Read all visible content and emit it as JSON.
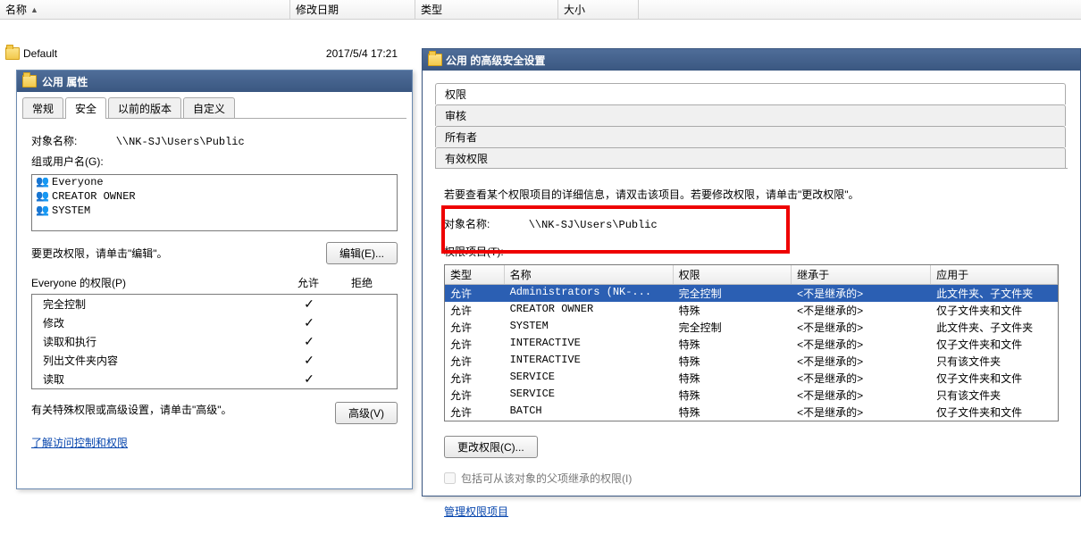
{
  "explorer": {
    "columns": {
      "name": "名称",
      "date": "修改日期",
      "type": "类型",
      "size": "大小"
    },
    "rows": [
      {
        "name": "Default",
        "date": "2017/5/4 17:21"
      }
    ]
  },
  "dialog1": {
    "title": "公用 属性",
    "tabs": [
      "常规",
      "安全",
      "以前的版本",
      "自定义"
    ],
    "active_tab": 1,
    "object_label": "对象名称:",
    "object_path": "\\\\NK-SJ\\Users\\Public",
    "group_label": "组或用户名(G):",
    "groups": [
      "Everyone",
      "CREATOR OWNER",
      "SYSTEM"
    ],
    "edit_hint": "要更改权限，请单击\"编辑\"。",
    "edit_btn": "编辑(E)...",
    "perm_header": "Everyone 的权限(P)",
    "allow_label": "允许",
    "deny_label": "拒绝",
    "perms": [
      {
        "name": "完全控制",
        "allow": true
      },
      {
        "name": "修改",
        "allow": true
      },
      {
        "name": "读取和执行",
        "allow": true
      },
      {
        "name": "列出文件夹内容",
        "allow": true
      },
      {
        "name": "读取",
        "allow": true
      }
    ],
    "adv_hint": "有关特殊权限或高级设置，请单击\"高级\"。",
    "adv_btn": "高级(V)",
    "learn_link": "了解访问控制和权限"
  },
  "dialog2": {
    "title": "公用 的高级安全设置",
    "tabs": [
      "权限",
      "审核",
      "所有者",
      "有效权限"
    ],
    "active_tab": 0,
    "hint": "若要查看某个权限项目的详细信息，请双击该项目。若要修改权限，请单击\"更改权限\"。",
    "object_label": "对象名称:",
    "object_path": "\\\\NK-SJ\\Users\\Public",
    "entries_label": "权限项目(T):",
    "columns": {
      "type": "类型",
      "name": "名称",
      "perm": "权限",
      "inherit": "继承于",
      "apply": "应用于"
    },
    "rows": [
      {
        "type": "允许",
        "name": "Administrators (NK-...",
        "perm": "完全控制",
        "inherit": "<不是继承的>",
        "apply": "此文件夹、子文件夹",
        "selected": true
      },
      {
        "type": "允许",
        "name": "CREATOR OWNER",
        "perm": "特殊",
        "inherit": "<不是继承的>",
        "apply": "仅子文件夹和文件"
      },
      {
        "type": "允许",
        "name": "SYSTEM",
        "perm": "完全控制",
        "inherit": "<不是继承的>",
        "apply": "此文件夹、子文件夹"
      },
      {
        "type": "允许",
        "name": "INTERACTIVE",
        "perm": "特殊",
        "inherit": "<不是继承的>",
        "apply": "仅子文件夹和文件"
      },
      {
        "type": "允许",
        "name": "INTERACTIVE",
        "perm": "特殊",
        "inherit": "<不是继承的>",
        "apply": "只有该文件夹"
      },
      {
        "type": "允许",
        "name": "SERVICE",
        "perm": "特殊",
        "inherit": "<不是继承的>",
        "apply": "仅子文件夹和文件"
      },
      {
        "type": "允许",
        "name": "SERVICE",
        "perm": "特殊",
        "inherit": "<不是继承的>",
        "apply": "只有该文件夹"
      },
      {
        "type": "允许",
        "name": "BATCH",
        "perm": "特殊",
        "inherit": "<不是继承的>",
        "apply": "仅子文件夹和文件"
      }
    ],
    "change_btn": "更改权限(C)...",
    "inherit_checkbox": "包括可从该对象的父项继承的权限(I)",
    "manage_link": "管理权限项目"
  }
}
